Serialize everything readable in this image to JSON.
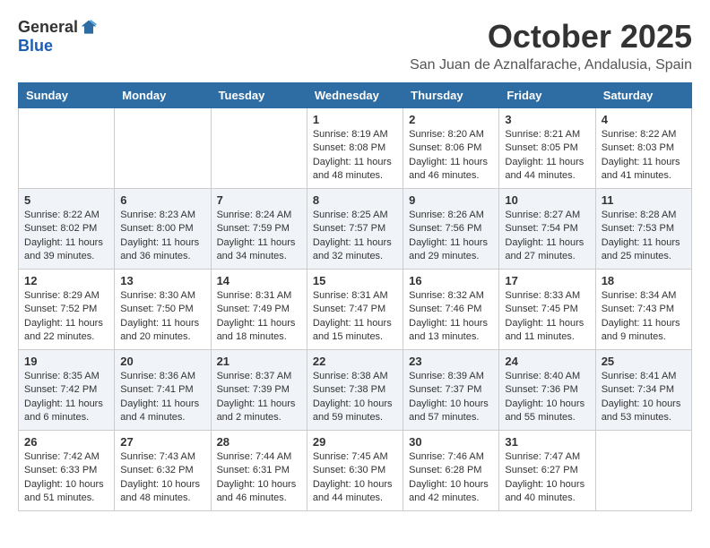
{
  "header": {
    "logo_general": "General",
    "logo_blue": "Blue",
    "month_year": "October 2025",
    "location": "San Juan de Aznalfarache, Andalusia, Spain"
  },
  "days_of_week": [
    "Sunday",
    "Monday",
    "Tuesday",
    "Wednesday",
    "Thursday",
    "Friday",
    "Saturday"
  ],
  "weeks": [
    [
      {
        "day": "",
        "info": ""
      },
      {
        "day": "",
        "info": ""
      },
      {
        "day": "",
        "info": ""
      },
      {
        "day": "1",
        "info": "Sunrise: 8:19 AM\nSunset: 8:08 PM\nDaylight: 11 hours\nand 48 minutes."
      },
      {
        "day": "2",
        "info": "Sunrise: 8:20 AM\nSunset: 8:06 PM\nDaylight: 11 hours\nand 46 minutes."
      },
      {
        "day": "3",
        "info": "Sunrise: 8:21 AM\nSunset: 8:05 PM\nDaylight: 11 hours\nand 44 minutes."
      },
      {
        "day": "4",
        "info": "Sunrise: 8:22 AM\nSunset: 8:03 PM\nDaylight: 11 hours\nand 41 minutes."
      }
    ],
    [
      {
        "day": "5",
        "info": "Sunrise: 8:22 AM\nSunset: 8:02 PM\nDaylight: 11 hours\nand 39 minutes."
      },
      {
        "day": "6",
        "info": "Sunrise: 8:23 AM\nSunset: 8:00 PM\nDaylight: 11 hours\nand 36 minutes."
      },
      {
        "day": "7",
        "info": "Sunrise: 8:24 AM\nSunset: 7:59 PM\nDaylight: 11 hours\nand 34 minutes."
      },
      {
        "day": "8",
        "info": "Sunrise: 8:25 AM\nSunset: 7:57 PM\nDaylight: 11 hours\nand 32 minutes."
      },
      {
        "day": "9",
        "info": "Sunrise: 8:26 AM\nSunset: 7:56 PM\nDaylight: 11 hours\nand 29 minutes."
      },
      {
        "day": "10",
        "info": "Sunrise: 8:27 AM\nSunset: 7:54 PM\nDaylight: 11 hours\nand 27 minutes."
      },
      {
        "day": "11",
        "info": "Sunrise: 8:28 AM\nSunset: 7:53 PM\nDaylight: 11 hours\nand 25 minutes."
      }
    ],
    [
      {
        "day": "12",
        "info": "Sunrise: 8:29 AM\nSunset: 7:52 PM\nDaylight: 11 hours\nand 22 minutes."
      },
      {
        "day": "13",
        "info": "Sunrise: 8:30 AM\nSunset: 7:50 PM\nDaylight: 11 hours\nand 20 minutes."
      },
      {
        "day": "14",
        "info": "Sunrise: 8:31 AM\nSunset: 7:49 PM\nDaylight: 11 hours\nand 18 minutes."
      },
      {
        "day": "15",
        "info": "Sunrise: 8:31 AM\nSunset: 7:47 PM\nDaylight: 11 hours\nand 15 minutes."
      },
      {
        "day": "16",
        "info": "Sunrise: 8:32 AM\nSunset: 7:46 PM\nDaylight: 11 hours\nand 13 minutes."
      },
      {
        "day": "17",
        "info": "Sunrise: 8:33 AM\nSunset: 7:45 PM\nDaylight: 11 hours\nand 11 minutes."
      },
      {
        "day": "18",
        "info": "Sunrise: 8:34 AM\nSunset: 7:43 PM\nDaylight: 11 hours\nand 9 minutes."
      }
    ],
    [
      {
        "day": "19",
        "info": "Sunrise: 8:35 AM\nSunset: 7:42 PM\nDaylight: 11 hours\nand 6 minutes."
      },
      {
        "day": "20",
        "info": "Sunrise: 8:36 AM\nSunset: 7:41 PM\nDaylight: 11 hours\nand 4 minutes."
      },
      {
        "day": "21",
        "info": "Sunrise: 8:37 AM\nSunset: 7:39 PM\nDaylight: 11 hours\nand 2 minutes."
      },
      {
        "day": "22",
        "info": "Sunrise: 8:38 AM\nSunset: 7:38 PM\nDaylight: 10 hours\nand 59 minutes."
      },
      {
        "day": "23",
        "info": "Sunrise: 8:39 AM\nSunset: 7:37 PM\nDaylight: 10 hours\nand 57 minutes."
      },
      {
        "day": "24",
        "info": "Sunrise: 8:40 AM\nSunset: 7:36 PM\nDaylight: 10 hours\nand 55 minutes."
      },
      {
        "day": "25",
        "info": "Sunrise: 8:41 AM\nSunset: 7:34 PM\nDaylight: 10 hours\nand 53 minutes."
      }
    ],
    [
      {
        "day": "26",
        "info": "Sunrise: 7:42 AM\nSunset: 6:33 PM\nDaylight: 10 hours\nand 51 minutes."
      },
      {
        "day": "27",
        "info": "Sunrise: 7:43 AM\nSunset: 6:32 PM\nDaylight: 10 hours\nand 48 minutes."
      },
      {
        "day": "28",
        "info": "Sunrise: 7:44 AM\nSunset: 6:31 PM\nDaylight: 10 hours\nand 46 minutes."
      },
      {
        "day": "29",
        "info": "Sunrise: 7:45 AM\nSunset: 6:30 PM\nDaylight: 10 hours\nand 44 minutes."
      },
      {
        "day": "30",
        "info": "Sunrise: 7:46 AM\nSunset: 6:28 PM\nDaylight: 10 hours\nand 42 minutes."
      },
      {
        "day": "31",
        "info": "Sunrise: 7:47 AM\nSunset: 6:27 PM\nDaylight: 10 hours\nand 40 minutes."
      },
      {
        "day": "",
        "info": ""
      }
    ]
  ]
}
